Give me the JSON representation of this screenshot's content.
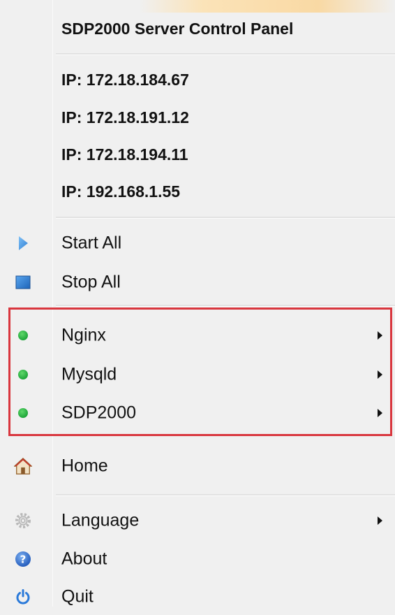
{
  "header": {
    "title": "SDP2000 Server Control Panel"
  },
  "ips": [
    "IP: 172.18.184.67",
    "IP: 172.18.191.12",
    "IP: 172.18.194.11",
    "IP: 192.168.1.55"
  ],
  "actions": {
    "start_all": "Start All",
    "stop_all": "Stop All"
  },
  "services": [
    {
      "label": "Nginx",
      "status": "running",
      "status_color": "#2db84a"
    },
    {
      "label": "Mysqld",
      "status": "running",
      "status_color": "#2db84a"
    },
    {
      "label": "SDP2000",
      "status": "running",
      "status_color": "#2db84a"
    }
  ],
  "bottom": {
    "home": "Home",
    "language": "Language",
    "about": "About",
    "quit": "Quit"
  },
  "colors": {
    "highlight_border": "#d9363e",
    "menu_bg": "#f0f0f0",
    "start_icon": "#3a86d8",
    "stop_icon": "#2f7fd4"
  },
  "icons": {
    "start_all": "play-icon",
    "stop_all": "stop-icon",
    "service_status": "green-dot-icon",
    "home": "home-icon",
    "language": "gear-icon",
    "about": "help-icon",
    "quit": "power-icon"
  }
}
